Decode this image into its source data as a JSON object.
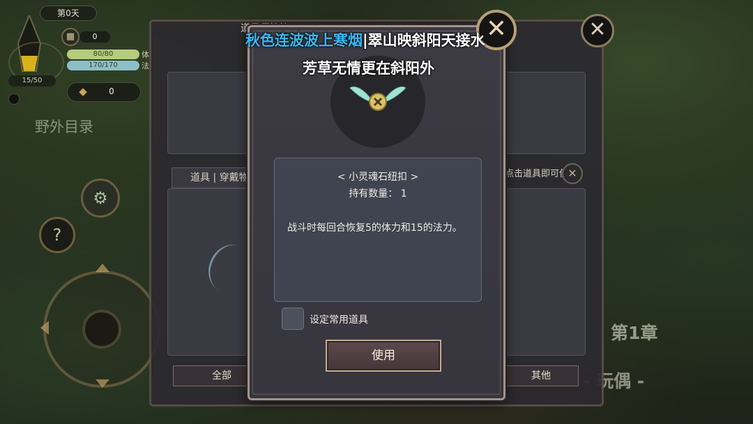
{
  "hud": {
    "day": "第0天",
    "level_counter": "15/50",
    "calendar_count": "0",
    "hp_text": "80/80",
    "hp_fraction": 1.0,
    "mp_text": "170/170",
    "mp_fraction": 1.0,
    "hp_tail": "体",
    "mp_tail": "法",
    "gold": "0",
    "field_directory": "野外目录",
    "help_symbol": "?",
    "gear_icon": "gear-icon"
  },
  "background_panel": {
    "title": "道具保管箱",
    "tab_label": "道具 | 穿戴物品",
    "hint": "点击道具即可使用",
    "bottom_tabs": {
      "all": "全部",
      "other": "其他"
    }
  },
  "scene": {
    "chapter": "第1章",
    "chapter_sub": "- 玩偶 -"
  },
  "dialog": {
    "close_symbol": "✕",
    "item_name": "< 小灵魂石纽扣 >",
    "item_quantity": "持有数量： 1",
    "item_description": "战斗时每回合恢复5的体力和15的法力。",
    "checkbox_label": "设定常用道具",
    "use_button": "使用"
  },
  "lyrics": {
    "line1_highlight": "秋色连波波上寒烟",
    "line1_rest": "翠山映斜阳天接水",
    "line2": "芳草无情更在斜阳外",
    "highlight_color": "#39b8ef"
  }
}
